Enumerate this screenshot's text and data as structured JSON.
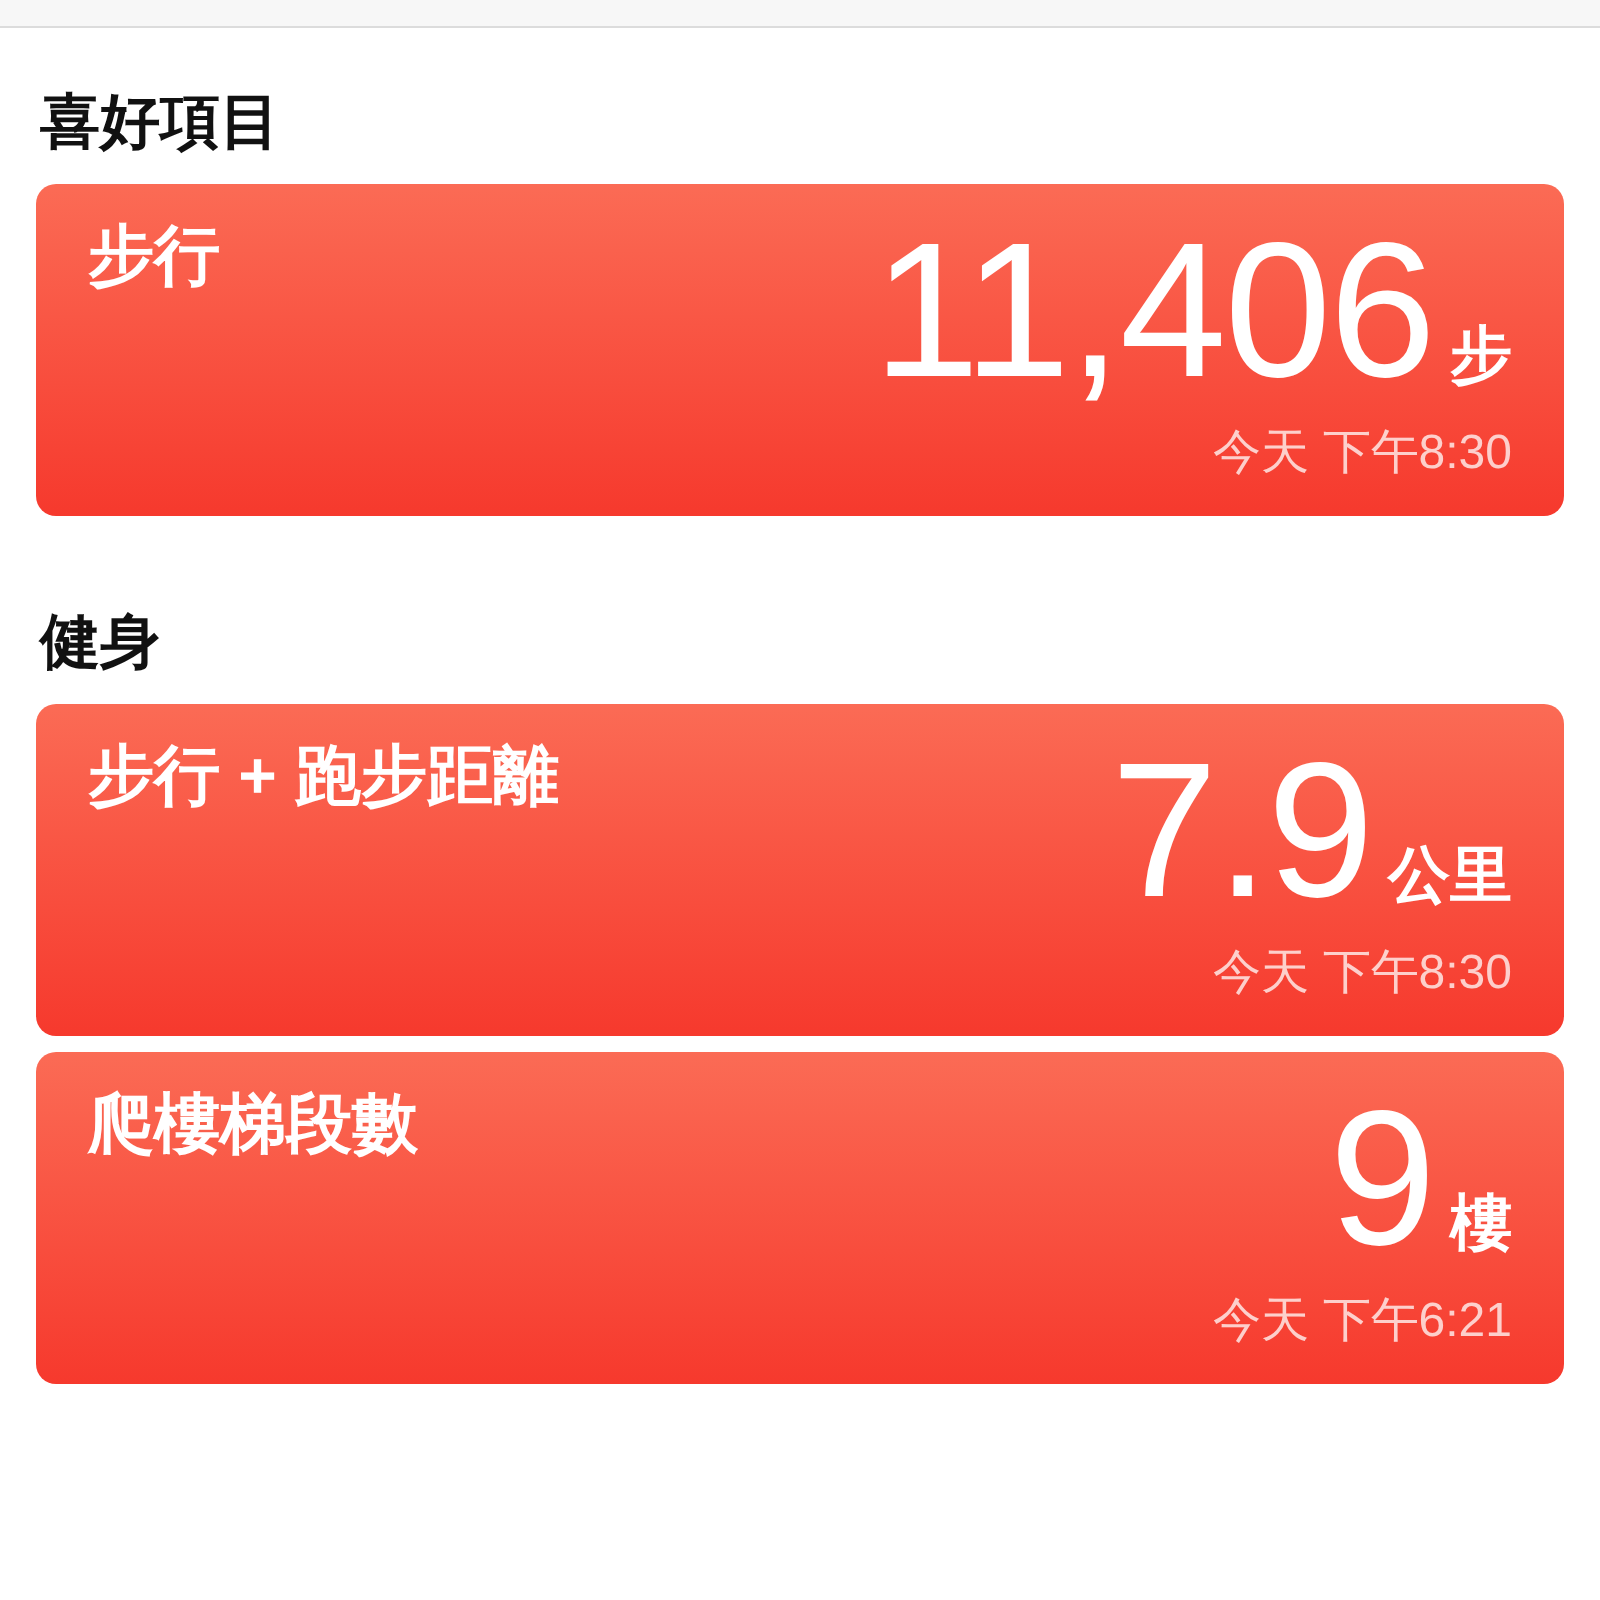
{
  "sections": [
    {
      "title": "喜好項目",
      "cards": [
        {
          "title": "步行",
          "value": "11,406",
          "unit": "步",
          "time": "今天 下午8:30"
        }
      ]
    },
    {
      "title": "健身",
      "cards": [
        {
          "title": "步行 + 跑步距離",
          "value": "7.9",
          "unit": "公里",
          "time": "今天 下午8:30"
        },
        {
          "title": "爬樓梯段數",
          "value": "9",
          "unit": "樓",
          "time": "今天 下午6:21"
        }
      ]
    }
  ]
}
